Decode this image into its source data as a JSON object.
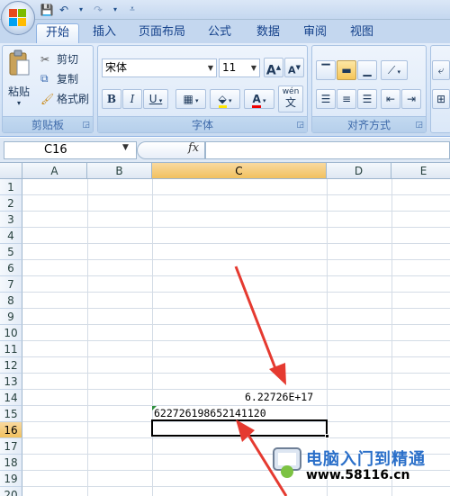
{
  "quick_access": {
    "icons": [
      "save-icon",
      "undo-icon",
      "redo-icon",
      "customize-icon"
    ]
  },
  "tabs": [
    "开始",
    "插入",
    "页面布局",
    "公式",
    "数据",
    "审阅",
    "视图"
  ],
  "ribbon": {
    "clipboard": {
      "paste": "粘贴",
      "cut": "剪切",
      "copy": "复制",
      "format_painter": "格式刷",
      "label": "剪贴板"
    },
    "font": {
      "font_name": "宋体",
      "font_size": "11",
      "bold": "B",
      "italic": "I",
      "underline": "U",
      "grow": "A",
      "shrink": "A",
      "font_color": "A",
      "wen": "wén",
      "wen_char": "文",
      "label": "字体"
    },
    "alignment": {
      "label": "对齐方式"
    }
  },
  "formula_bar": {
    "name_box": "C16",
    "fx": "fx",
    "formula": ""
  },
  "columns": [
    "A",
    "B",
    "C",
    "D",
    "E"
  ],
  "rows": [
    "1",
    "2",
    "3",
    "4",
    "5",
    "6",
    "7",
    "8",
    "9",
    "10",
    "11",
    "12",
    "13",
    "14",
    "15",
    "16",
    "17",
    "18",
    "19",
    "20"
  ],
  "cells": {
    "C14": "6.22726E+17",
    "C15": "622726198652141120"
  },
  "selected": {
    "column": "C",
    "row": "16"
  },
  "watermark": {
    "title": "电脑入门到精通",
    "url": "www.58116.cn"
  },
  "colors": {
    "accent_blue": "#15428b",
    "arrow_red": "#e53a30",
    "selection_orange": "#f1c15f"
  }
}
